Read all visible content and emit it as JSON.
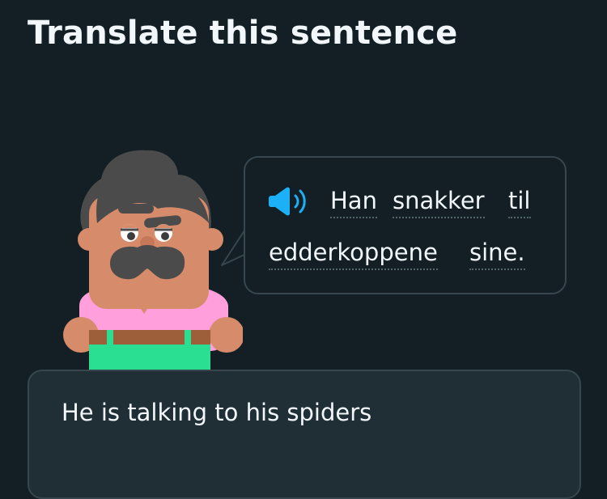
{
  "header": {
    "title": "Translate this sentence"
  },
  "character": {
    "name": "character-avatar"
  },
  "prompt": {
    "speaker_icon": "speaker-icon",
    "words": [
      "Han",
      "snakker",
      "til",
      "edderkoppene",
      "sine."
    ]
  },
  "answer": {
    "value": "He is talking to his spiders"
  },
  "colors": {
    "background": "#131f24",
    "text": "#f1f7fb",
    "border": "#37464f",
    "answer_bg": "#202f36",
    "speaker_blue": "#1cb0f6",
    "shirt_pink": "#ff9fdc",
    "pants_green": "#2bdf92"
  }
}
